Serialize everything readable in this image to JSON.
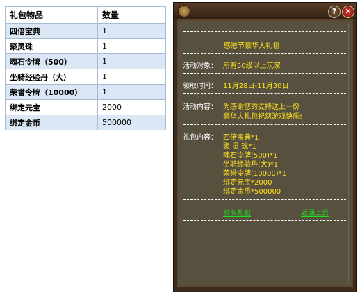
{
  "table": {
    "headers": [
      "礼包物品",
      "数量"
    ],
    "rows": [
      {
        "name": "四倍宝典",
        "qty": "1"
      },
      {
        "name": "聚灵珠",
        "qty": "1"
      },
      {
        "name": "魂石令牌（500）",
        "qty": "1"
      },
      {
        "name": "坐骑经验丹（大）",
        "qty": "1"
      },
      {
        "name": "荣誉令牌（10000）",
        "qty": "1"
      },
      {
        "name": "绑定元宝",
        "qty": "2000"
      },
      {
        "name": "绑定金币",
        "qty": "500000"
      }
    ]
  },
  "panel": {
    "help_glyph": "?",
    "close_glyph": "✕",
    "title": "感恩节豪华大礼包",
    "target_label": "活动对象：",
    "target_value": "所有50级以上玩家",
    "time_label": "领取时间：",
    "time_value": "11月28日-11月30日",
    "content_label": "活动内容：",
    "content_lines": [
      "为感谢您的支持送上一份",
      "豪华大礼包祝您游戏快乐!"
    ],
    "pack_label": "礼包内容：",
    "pack_items": [
      "四倍宝典*1",
      "聚 灵 珠*1",
      "魂石令牌(500)*1",
      "坐骑经验丹(大)*1",
      "荣誉令牌(10000)*1",
      "绑定元宝*2000",
      "绑定金币*500000"
    ],
    "claim_link": "领取礼包",
    "back_link": "返回上页"
  },
  "colors": {
    "highlight_yellow": "#ffe11f",
    "link_green": "#19e21a",
    "table_alt_row": "#dbe7f4",
    "close_red": "#d63a2a"
  }
}
